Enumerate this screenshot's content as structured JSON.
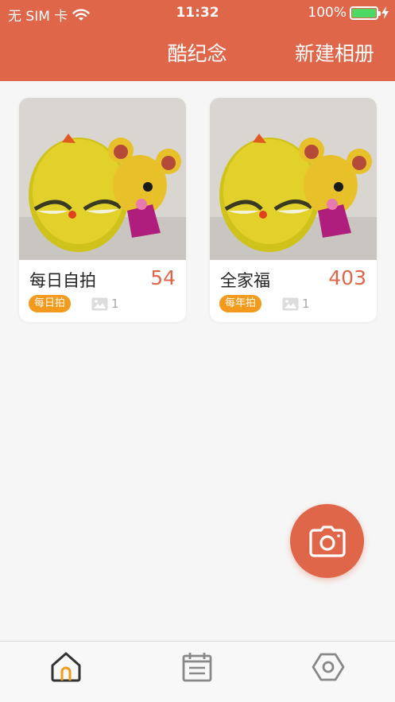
{
  "status_bar": {
    "carrier": "无 SIM 卡",
    "time": "11:32",
    "battery_percent": "100%",
    "battery_level": 1.0
  },
  "header": {
    "title": "酷纪念",
    "action_label": "新建相册"
  },
  "albums": [
    {
      "name": "每日自拍",
      "count": "54",
      "tag": "每日拍",
      "photo_count": "1"
    },
    {
      "name": "全家福",
      "count": "403",
      "tag": "每年拍",
      "photo_count": "1"
    }
  ],
  "tabbar": {
    "items": [
      {
        "icon": "home-icon",
        "active": true
      },
      {
        "icon": "calendar-icon",
        "active": false
      },
      {
        "icon": "settings-hexagon-icon",
        "active": false
      }
    ]
  },
  "colors": {
    "accent": "#e0664a",
    "tag": "#f39a1c",
    "battery": "#4cd964",
    "active_tab": "#f39a1c"
  }
}
